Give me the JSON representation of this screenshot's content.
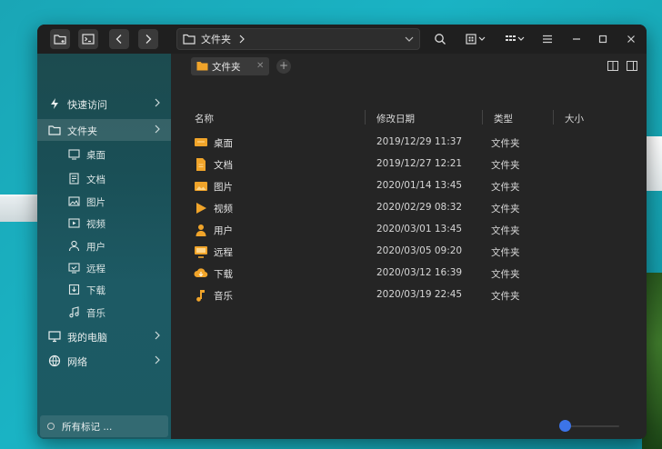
{
  "window": {
    "address": {
      "crumb": "文件夹"
    },
    "view_icons": [
      "grid-view-icon",
      "list-view-icon",
      "menu-icon"
    ],
    "controls": [
      "minimize",
      "maximize",
      "close"
    ]
  },
  "sidebar": {
    "quick_access": "快速访问",
    "folders": "文件夹",
    "folder_items": [
      {
        "label": "桌面",
        "icon": "desktop-icon"
      },
      {
        "label": "文档",
        "icon": "document-icon"
      },
      {
        "label": "图片",
        "icon": "picture-icon"
      },
      {
        "label": "视频",
        "icon": "video-icon"
      },
      {
        "label": "用户",
        "icon": "user-icon"
      },
      {
        "label": "远程",
        "icon": "remote-icon"
      },
      {
        "label": "下载",
        "icon": "download-icon"
      },
      {
        "label": "音乐",
        "icon": "music-icon"
      }
    ],
    "my_computer": "我的电脑",
    "network": "网络",
    "all_tags": "所有标记 ..."
  },
  "tabs": [
    {
      "label": "文件夹"
    }
  ],
  "table": {
    "headers": {
      "name": "名称",
      "modified": "修改日期",
      "type": "类型",
      "size": "大小"
    },
    "rows": [
      {
        "name": "桌面",
        "date": "2019/12/29 11:37",
        "type": "文件夹",
        "icon": "desktop-folder-icon"
      },
      {
        "name": "文档",
        "date": "2019/12/27 12:21",
        "type": "文件夹",
        "icon": "document-folder-icon"
      },
      {
        "name": "图片",
        "date": "2020/01/14 13:45",
        "type": "文件夹",
        "icon": "picture-folder-icon"
      },
      {
        "name": "视频",
        "date": "2020/02/29 08:32",
        "type": "文件夹",
        "icon": "video-folder-icon"
      },
      {
        "name": "用户",
        "date": "2020/03/01 13:45",
        "type": "文件夹",
        "icon": "user-folder-icon"
      },
      {
        "name": "远程",
        "date": "2020/03/05 09:20",
        "type": "文件夹",
        "icon": "remote-folder-icon"
      },
      {
        "name": "下载",
        "date": "2020/03/12 16:39",
        "type": "文件夹",
        "icon": "download-folder-icon"
      },
      {
        "name": "音乐",
        "date": "2020/03/19 22:45",
        "type": "文件夹",
        "icon": "music-folder-icon"
      }
    ]
  },
  "zoom": {
    "level": 0.0
  },
  "colors": {
    "accent": "#3c74e8",
    "folder": "#f0a42a"
  }
}
